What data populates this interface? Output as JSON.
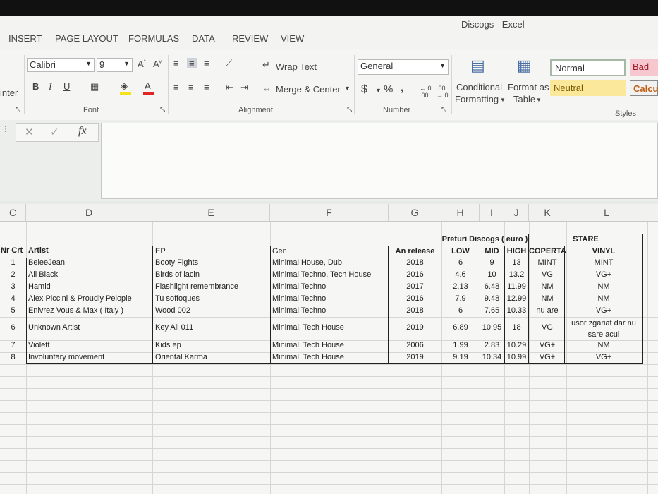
{
  "window": {
    "title": "Discogs - Excel"
  },
  "menu": {
    "items": [
      "INSERT",
      "PAGE LAYOUT",
      "FORMULAS",
      "DATA",
      "REVIEW",
      "VIEW"
    ]
  },
  "ribbon": {
    "left_cut_label": "inter",
    "font": {
      "name": "Calibri",
      "size": "9",
      "group_label": "Font"
    },
    "alignment": {
      "wrap_text": "Wrap Text",
      "merge_center": "Merge & Center",
      "group_label": "Alignment"
    },
    "number": {
      "format": "General",
      "currency": "$",
      "percent": "%",
      "comma": ",",
      "group_label": "Number"
    },
    "styles": {
      "conditional_formatting": [
        "Conditional",
        "Formatting"
      ],
      "format_as_table": [
        "Format as",
        "Table"
      ],
      "normal": "Normal",
      "bad": "Bad",
      "neutral": "Neutral",
      "calc": "Calcu",
      "group_label": "Styles"
    }
  },
  "formula_bar": {
    "fx": "fx",
    "value": ""
  },
  "columns": [
    "C",
    "D",
    "E",
    "F",
    "G",
    "H",
    "I",
    "J",
    "K",
    "L"
  ],
  "sheet": {
    "price_header": "Preturi Discogs ( euro )",
    "stare_header": "STARE",
    "headers": [
      "Nr Crt",
      "Artist",
      "EP",
      "Gen",
      "An release",
      "LOW",
      "MID",
      "HIGH",
      "COPERTA",
      "VINYL"
    ],
    "rows": [
      [
        "1",
        "BeleeJean",
        "Booty Fights",
        "Minimal House, Dub",
        "2018",
        "6",
        "9",
        "13",
        "MINT",
        "MINT"
      ],
      [
        "2",
        "All Black",
        "Birds of lacin",
        "Minimal Techno, Tech House",
        "2016",
        "4.6",
        "10",
        "13.2",
        "VG",
        "VG+"
      ],
      [
        "3",
        "Hamid",
        "Flashlight remembrance",
        "Minimal Techno",
        "2017",
        "2.13",
        "6.48",
        "11.99",
        "NM",
        "NM"
      ],
      [
        "4",
        "Alex Piccini & Proudly Pelople",
        "Tu soffoques",
        "Minimal Techno",
        "2016",
        "7.9",
        "9.48",
        "12.99",
        "NM",
        "NM"
      ],
      [
        "5",
        "Enivrez Vous & Max ( Italy )",
        "Wood 002",
        "Minimal Techno",
        "2018",
        "6",
        "7.65",
        "10.33",
        "nu are",
        "VG+"
      ],
      [
        "6",
        "Unknown Artist",
        "Key All 011",
        "Minimal, Tech House",
        "2019",
        "6.89",
        "10.95",
        "18",
        "VG",
        "usor zgariat dar nu sare acul"
      ],
      [
        "7",
        "Violett",
        "Kids ep",
        "Minimal, Tech House",
        "2006",
        "1.99",
        "2.83",
        "10.29",
        "VG+",
        "NM"
      ],
      [
        "8",
        "Involuntary movement",
        "Oriental Karma",
        "Minimal, Tech House",
        "2019",
        "9.19",
        "10.34",
        "10.99",
        "VG+",
        "VG+"
      ]
    ]
  }
}
